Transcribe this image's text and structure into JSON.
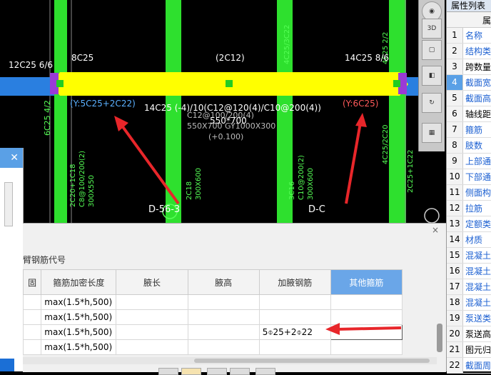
{
  "cad": {
    "label_left_top": "12C25 6/6",
    "label_8c25": "8C25",
    "label_2c12": "(2C12)",
    "label_right_top": "14C25 8/6",
    "label_y_left": "(Y:5C25+2C22)",
    "label_stirrup": "14C25 (-4)/10(C12@120(4)/C10@200(4))",
    "label_size": "550*700",
    "label_y_right": "(Y:6C25)",
    "label_d_left": "D-56-3",
    "label_d_right": "D-C"
  },
  "toolbar": {
    "buttons": [
      "globe-icon",
      "3d-box-icon",
      "box-icon",
      "box-front-icon",
      "rotate-icon",
      "grid-icon"
    ],
    "label_3d": "3D"
  },
  "properties": {
    "title": "属性列表",
    "header_second": "属",
    "rows": [
      {
        "num": "1",
        "name": "名称",
        "color": "blue"
      },
      {
        "num": "2",
        "name": "结构类",
        "color": "blue"
      },
      {
        "num": "3",
        "name": "跨数量",
        "color": "black"
      },
      {
        "num": "4",
        "name": "截面宽",
        "color": "blue",
        "selected": true
      },
      {
        "num": "5",
        "name": "截面高",
        "color": "blue"
      },
      {
        "num": "6",
        "name": "轴线距",
        "color": "black"
      },
      {
        "num": "7",
        "name": "箍筋",
        "color": "blue"
      },
      {
        "num": "8",
        "name": "肢数",
        "color": "blue"
      },
      {
        "num": "9",
        "name": "上部通",
        "color": "blue"
      },
      {
        "num": "10",
        "name": "下部通",
        "color": "blue"
      },
      {
        "num": "11",
        "name": "侧面构",
        "color": "blue"
      },
      {
        "num": "12",
        "name": "拉筋",
        "color": "blue"
      },
      {
        "num": "13",
        "name": "定额类",
        "color": "blue"
      },
      {
        "num": "14",
        "name": "材质",
        "color": "blue"
      },
      {
        "num": "15",
        "name": "混凝土",
        "color": "blue"
      },
      {
        "num": "16",
        "name": "混凝土",
        "color": "blue"
      },
      {
        "num": "17",
        "name": "混凝土",
        "color": "blue"
      },
      {
        "num": "18",
        "name": "混凝土",
        "color": "blue"
      },
      {
        "num": "19",
        "name": "泵送类",
        "color": "blue"
      },
      {
        "num": "20",
        "name": "泵送高",
        "color": "black"
      },
      {
        "num": "21",
        "name": "图元归",
        "color": "black"
      },
      {
        "num": "22",
        "name": "截面周",
        "color": "blue"
      }
    ]
  },
  "left_panel": {
    "close": "✕"
  },
  "bottom": {
    "close": "×",
    "subtitle": "臂钢筋代号",
    "columns": [
      "固",
      "箍筋加密长度",
      "腋长",
      "腋高",
      "加腋钢筋",
      "其他箍筋"
    ],
    "rows": [
      [
        "",
        "max(1.5*h,500)",
        "",
        "",
        "",
        ""
      ],
      [
        "",
        "max(1.5*h,500)",
        "",
        "",
        "",
        ""
      ],
      [
        "",
        "max(1.5*h,500)",
        "",
        "",
        "5⌽25+2⌽22",
        ""
      ],
      [
        "",
        "max(1.5*h,500)",
        "",
        "",
        "",
        ""
      ]
    ]
  },
  "colors": {
    "beam_yellow": "#ffff00",
    "column_green": "#33dd33",
    "cad_bg": "#000000",
    "arrow_red": "#e8262a",
    "accent_blue": "#5aa0e6"
  }
}
